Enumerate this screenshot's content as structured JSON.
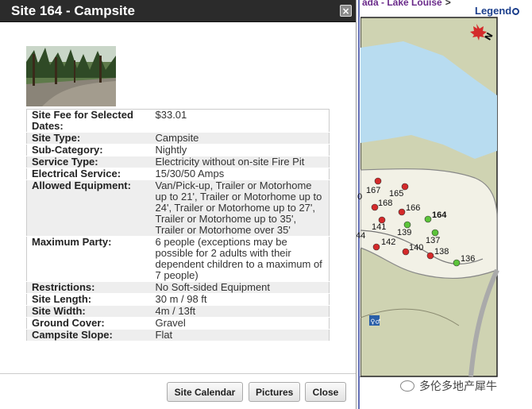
{
  "dialog": {
    "title": "Site 164 - Campsite",
    "close_label": "×",
    "details": [
      {
        "label": "Site Fee for Selected Dates:",
        "value": "$33.01"
      },
      {
        "label": "Site Type:",
        "value": "Campsite"
      },
      {
        "label": "Sub-Category:",
        "value": "Nightly"
      },
      {
        "label": "Service Type:",
        "value": "Electricity without on-site Fire Pit"
      },
      {
        "label": "Electrical Service:",
        "value": "15/30/50 Amps"
      },
      {
        "label": "Allowed Equipment:",
        "value": "Van/Pick-up, Trailer or Motorhome up to 21', Trailer or Motorhome up to 24', Trailer or Motorhome up to 27', Trailer or Motorhome up to 35', Trailer or Motorhome over 35'"
      },
      {
        "label": "Maximum Party:",
        "value": "6 people (exceptions may be possible for 2 adults with their dependent children to a maximum of 7 people)"
      },
      {
        "label": "Restrictions:",
        "value": "No Soft-sided Equipment"
      },
      {
        "label": "Site Length:",
        "value": "30 m / 98 ft"
      },
      {
        "label": "Site Width:",
        "value": "4m / 13ft"
      },
      {
        "label": "Ground Cover:",
        "value": "Gravel"
      },
      {
        "label": "Campsite Slope:",
        "value": "Flat"
      }
    ],
    "buttons": {
      "calendar": "Site Calendar",
      "pictures": "Pictures",
      "close": "Close"
    }
  },
  "map": {
    "breadcrumb_fragment": "ada - Lake Louise",
    "breadcrumb_separator": ">",
    "legend_label": "Legend",
    "north_label": "N",
    "selected_site": "164",
    "sites": [
      {
        "label": "167",
        "status": "reserved"
      },
      {
        "label": "165",
        "status": "reserved"
      },
      {
        "label": "168",
        "status": "reserved"
      },
      {
        "label": "166",
        "status": "reserved"
      },
      {
        "label": "164",
        "status": "available"
      },
      {
        "label": "141",
        "status": "reserved"
      },
      {
        "label": "139",
        "status": "available"
      },
      {
        "label": "137",
        "status": "available"
      },
      {
        "label": "142",
        "status": "reserved"
      },
      {
        "label": "140",
        "status": "reserved"
      },
      {
        "label": "138",
        "status": "reserved"
      },
      {
        "label": "136",
        "status": "available"
      }
    ],
    "partial_labels": [
      "0",
      "44"
    ],
    "colors": {
      "reserved": "#d42a2a",
      "available": "#5cc43a",
      "water": "#b8dcf0",
      "campground": "#f2f1e6",
      "terrain": "#cfd3b2"
    }
  },
  "watermark": "多伦多地产犀牛"
}
